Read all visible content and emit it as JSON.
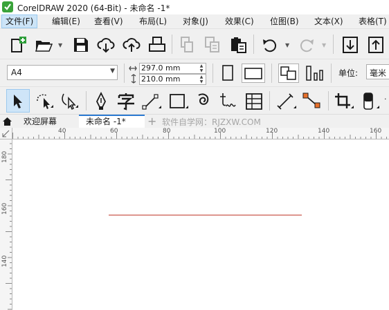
{
  "window": {
    "title": "CorelDRAW 2020 (64-Bit) - 未命名 -1*",
    "logo_icon": "coreldraw-logo-icon"
  },
  "menu": {
    "items": [
      {
        "label": "文件(F)",
        "active": true
      },
      {
        "label": "编辑(E)"
      },
      {
        "label": "查看(V)"
      },
      {
        "label": "布局(L)"
      },
      {
        "label": "对象(J)"
      },
      {
        "label": "效果(C)"
      },
      {
        "label": "位图(B)"
      },
      {
        "label": "文本(X)"
      },
      {
        "label": "表格(T)"
      }
    ]
  },
  "standard_toolbar": {
    "icons": [
      "new-document-icon",
      "open-folder-icon",
      "save-icon",
      "cloud-download-icon",
      "cloud-upload-icon",
      "print-icon",
      "copy-icon",
      "duplicate-icon",
      "paste-icon",
      "undo-icon",
      "redo-icon",
      "import-icon",
      "export-icon"
    ]
  },
  "property_bar": {
    "paper_size": "A4",
    "width": "297.0 mm",
    "height": "210.0 mm",
    "unit_label": "单位:",
    "unit_value": "毫米",
    "icons": [
      "portrait-icon",
      "landscape-icon",
      "all-pages-icon",
      "current-page-icon"
    ]
  },
  "toolbox": {
    "tools": [
      "pick-tool-icon",
      "freehand-pick-icon",
      "shape-tool-icon",
      "pen-tool-icon",
      "text-tool-icon",
      "line-tool-icon",
      "rectangle-tool-icon",
      "spiral-tool-icon",
      "artistic-text-icon",
      "table-tool-icon",
      "dimension-tool-icon",
      "connector-tool-icon",
      "crop-tool-icon",
      "eraser-tool-icon"
    ]
  },
  "tabs": {
    "welcome": "欢迎屏幕",
    "document": "未命名 -1*",
    "add": "+",
    "watermark": "软件自学网：RJZXW.COM"
  },
  "ruler": {
    "h_labels": [
      "40",
      "60",
      "80",
      "100",
      "120",
      "140",
      "160"
    ],
    "v_labels": [
      "180",
      "160",
      "140"
    ]
  },
  "colors": {
    "line": "#c0392b",
    "menu_active": "#cce4f7",
    "chrome": "#f0f0f0"
  }
}
